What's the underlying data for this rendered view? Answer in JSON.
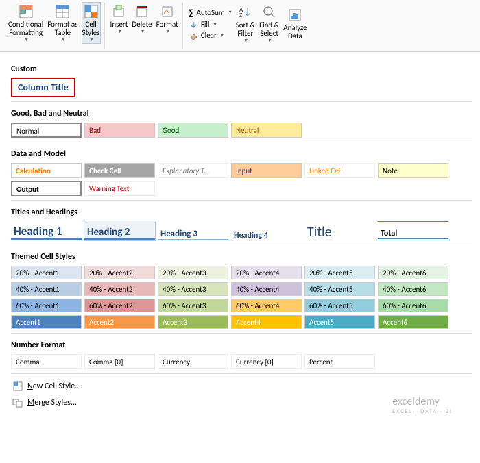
{
  "ribbon": {
    "cond_fmt": "Conditional\nFormatting",
    "fmt_table": "Format as\nTable",
    "cell_styles": "Cell\nStyles",
    "insert": "Insert",
    "delete": "Delete",
    "format": "Format",
    "autosum": "AutoSum",
    "fill": "Fill",
    "clear": "Clear",
    "sort": "Sort &\nFilter",
    "find": "Find &\nSelect",
    "analyze": "Analyze\nData"
  },
  "sections": {
    "custom": "Custom",
    "gbn": "Good, Bad and Neutral",
    "dm": "Data and Model",
    "th": "Titles and Headings",
    "themed": "Themed Cell Styles",
    "numfmt": "Number Format"
  },
  "custom_style": "Column Title",
  "gbn_row": {
    "normal": "Normal",
    "bad": "Bad",
    "good": "Good",
    "neutral": "Neutral"
  },
  "dm_row": {
    "calc": "Calculation",
    "check": "Check Cell",
    "expl": "Explanatory T...",
    "input": "Input",
    "linked": "Linked Cell",
    "note": "Note",
    "output": "Output",
    "warn": "Warning Text"
  },
  "headings": {
    "h1": "Heading 1",
    "h2": "Heading 2",
    "h3": "Heading 3",
    "h4": "Heading 4",
    "title": "Title",
    "total": "Total"
  },
  "accents": {
    "rows": [
      [
        "20% - Accent1",
        "20% - Accent2",
        "20% - Accent3",
        "20% - Accent4",
        "20% - Accent5",
        "20% - Accent6"
      ],
      [
        "40% - Accent1",
        "40% - Accent2",
        "40% - Accent3",
        "40% - Accent4",
        "40% - Accent5",
        "40% - Accent6"
      ],
      [
        "60% - Accent1",
        "60% - Accent2",
        "60% - Accent3",
        "60% - Accent4",
        "60% - Accent5",
        "60% - Accent6"
      ],
      [
        "Accent1",
        "Accent2",
        "Accent3",
        "Accent4",
        "Accent5",
        "Accent6"
      ]
    ],
    "colors": {
      "c1": [
        "#dce6f2",
        "#b9cde5",
        "#8eb4e3",
        "#4f81bd"
      ],
      "c2": [
        "#f2dcdb",
        "#e6b9b8",
        "#da9694",
        "#f79646"
      ],
      "c3": [
        "#ebf1de",
        "#d7e4bc",
        "#c4d79b",
        "#9bbb59"
      ],
      "c4": [
        "#e6e0ec",
        "#ccc0da",
        "#ffcc66",
        "#ffc000"
      ],
      "c5": [
        "#dbeef4",
        "#b7dee8",
        "#93cddd",
        "#4bacc6"
      ],
      "c6": [
        "#e5f3e5",
        "#c3e6c3",
        "#a8dba8",
        "#70ad47"
      ]
    }
  },
  "numfmt_row": [
    "Comma",
    "Comma [0]",
    "Currency",
    "Currency [0]",
    "Percent"
  ],
  "menu": {
    "new": "New Cell Style...",
    "merge": "Merge Styles..."
  },
  "watermark": {
    "main": "exceldemy",
    "sub": "EXCEL · DATA · BI"
  }
}
